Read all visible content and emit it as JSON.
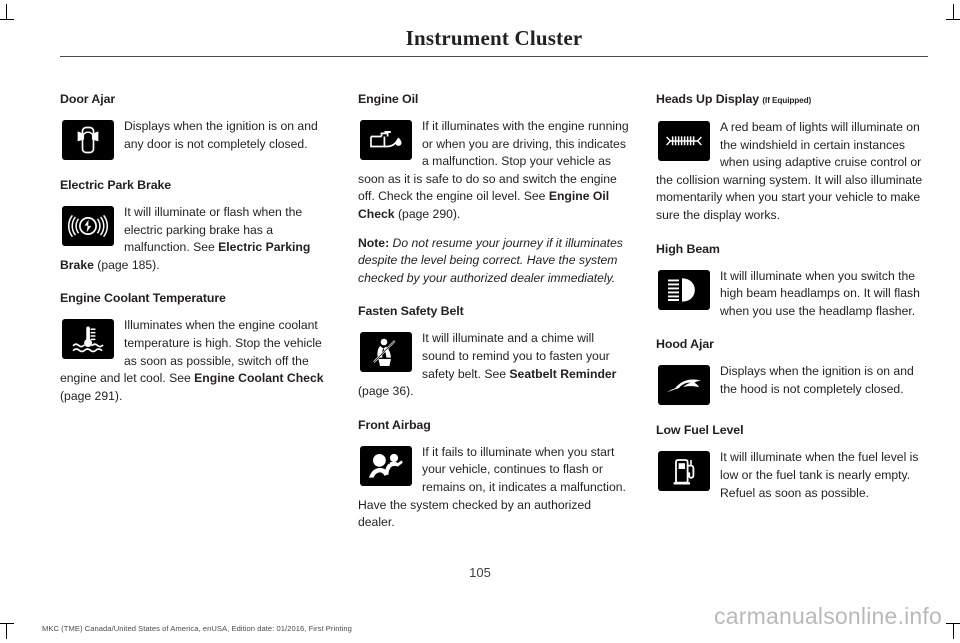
{
  "header": {
    "title": "Instrument Cluster"
  },
  "footer": {
    "page_number": "105",
    "imprint": "MKC (TME) Canada/United States of America, enUSA, Edition date: 01/2016, First Printing",
    "watermark": "carmanualsonline.info"
  },
  "colors": {
    "text": "#231f20",
    "rule": "#4a4a4a",
    "telltale_bg": "#000000",
    "telltale_fg": "#ffffff",
    "watermark": "#b9b9b9"
  },
  "columns": [
    {
      "sections": [
        {
          "title": "Door Ajar",
          "qualifier": "",
          "icon": "door-ajar-telltale-icon",
          "paragraphs": [
            {
              "style": "normal",
              "runs": [
                {
                  "text": "Displays when the ignition is on and any door is not completely closed.",
                  "bold": false
                }
              ]
            }
          ]
        },
        {
          "title": "Electric Park Brake",
          "qualifier": "",
          "icon": "electric-park-brake-telltale-icon",
          "paragraphs": [
            {
              "style": "normal",
              "runs": [
                {
                  "text": "It will illuminate or flash when the electric parking brake has a malfunction.  See ",
                  "bold": false
                },
                {
                  "text": "Electric Parking Brake",
                  "bold": true
                },
                {
                  "text": " (page 185).",
                  "bold": false
                }
              ]
            }
          ]
        },
        {
          "title": "Engine Coolant Temperature",
          "qualifier": "",
          "icon": "engine-coolant-temperature-telltale-icon",
          "paragraphs": [
            {
              "style": "normal",
              "runs": [
                {
                  "text": "Illuminates when the engine coolant temperature is high. Stop the vehicle as soon as possible, switch off the engine and let cool.  See ",
                  "bold": false
                },
                {
                  "text": "Engine Coolant Check",
                  "bold": true
                },
                {
                  "text": " (page 291).",
                  "bold": false
                }
              ]
            }
          ]
        }
      ]
    },
    {
      "sections": [
        {
          "title": "Engine Oil",
          "qualifier": "",
          "icon": "engine-oil-telltale-icon",
          "paragraphs": [
            {
              "style": "normal",
              "runs": [
                {
                  "text": "If it illuminates with the engine running or when you are driving, this indicates a malfunction. Stop your vehicle as soon as it is safe to do so and switch the engine off. Check the engine oil level.  See ",
                  "bold": false
                },
                {
                  "text": "Engine Oil Check",
                  "bold": true
                },
                {
                  "text": " (page 290).",
                  "bold": false
                }
              ]
            },
            {
              "style": "note",
              "label": "Note:",
              "runs": [
                {
                  "text": " Do not resume your journey if it illuminates despite the level being correct. Have the system checked by your authorized dealer immediately.",
                  "bold": false
                }
              ]
            }
          ]
        },
        {
          "title": "Fasten Safety Belt",
          "qualifier": "",
          "icon": "fasten-safety-belt-telltale-icon",
          "paragraphs": [
            {
              "style": "normal",
              "runs": [
                {
                  "text": "It will illuminate and a chime will sound to remind you to fasten your safety belt.  See ",
                  "bold": false
                },
                {
                  "text": "Seatbelt Reminder",
                  "bold": true
                },
                {
                  "text": " (page 36).",
                  "bold": false
                }
              ]
            }
          ]
        },
        {
          "title": "Front Airbag",
          "qualifier": "",
          "icon": "front-airbag-telltale-icon",
          "paragraphs": [
            {
              "style": "normal",
              "runs": [
                {
                  "text": "If it fails to illuminate when you start your vehicle, continues to flash or remains on, it indicates a malfunction. Have the system checked by an authorized dealer.",
                  "bold": false
                }
              ]
            }
          ]
        }
      ]
    },
    {
      "sections": [
        {
          "title": "Heads Up Display",
          "qualifier": "(If Equipped)",
          "icon": "heads-up-display-telltale-icon",
          "paragraphs": [
            {
              "style": "normal",
              "runs": [
                {
                  "text": "A red beam of lights will illuminate on the windshield in certain instances when using adaptive cruise control or the collision warning system. It will also illuminate momentarily when you start your vehicle to make sure the display works.",
                  "bold": false
                }
              ]
            }
          ]
        },
        {
          "title": "High Beam",
          "qualifier": "",
          "icon": "high-beam-telltale-icon",
          "paragraphs": [
            {
              "style": "normal",
              "runs": [
                {
                  "text": "It will illuminate when you switch the high beam headlamps on. It will flash when you use the headlamp flasher.",
                  "bold": false
                }
              ]
            }
          ]
        },
        {
          "title": "Hood Ajar",
          "qualifier": "",
          "icon": "hood-ajar-telltale-icon",
          "paragraphs": [
            {
              "style": "normal",
              "runs": [
                {
                  "text": "Displays when the ignition is on and the hood is not completely closed.",
                  "bold": false
                }
              ]
            }
          ]
        },
        {
          "title": "Low Fuel Level",
          "qualifier": "",
          "icon": "low-fuel-level-telltale-icon",
          "paragraphs": [
            {
              "style": "normal",
              "runs": [
                {
                  "text": "It will illuminate when the fuel level is low or the fuel tank is nearly empty. Refuel as soon as possible.",
                  "bold": false
                }
              ]
            }
          ]
        }
      ]
    }
  ]
}
